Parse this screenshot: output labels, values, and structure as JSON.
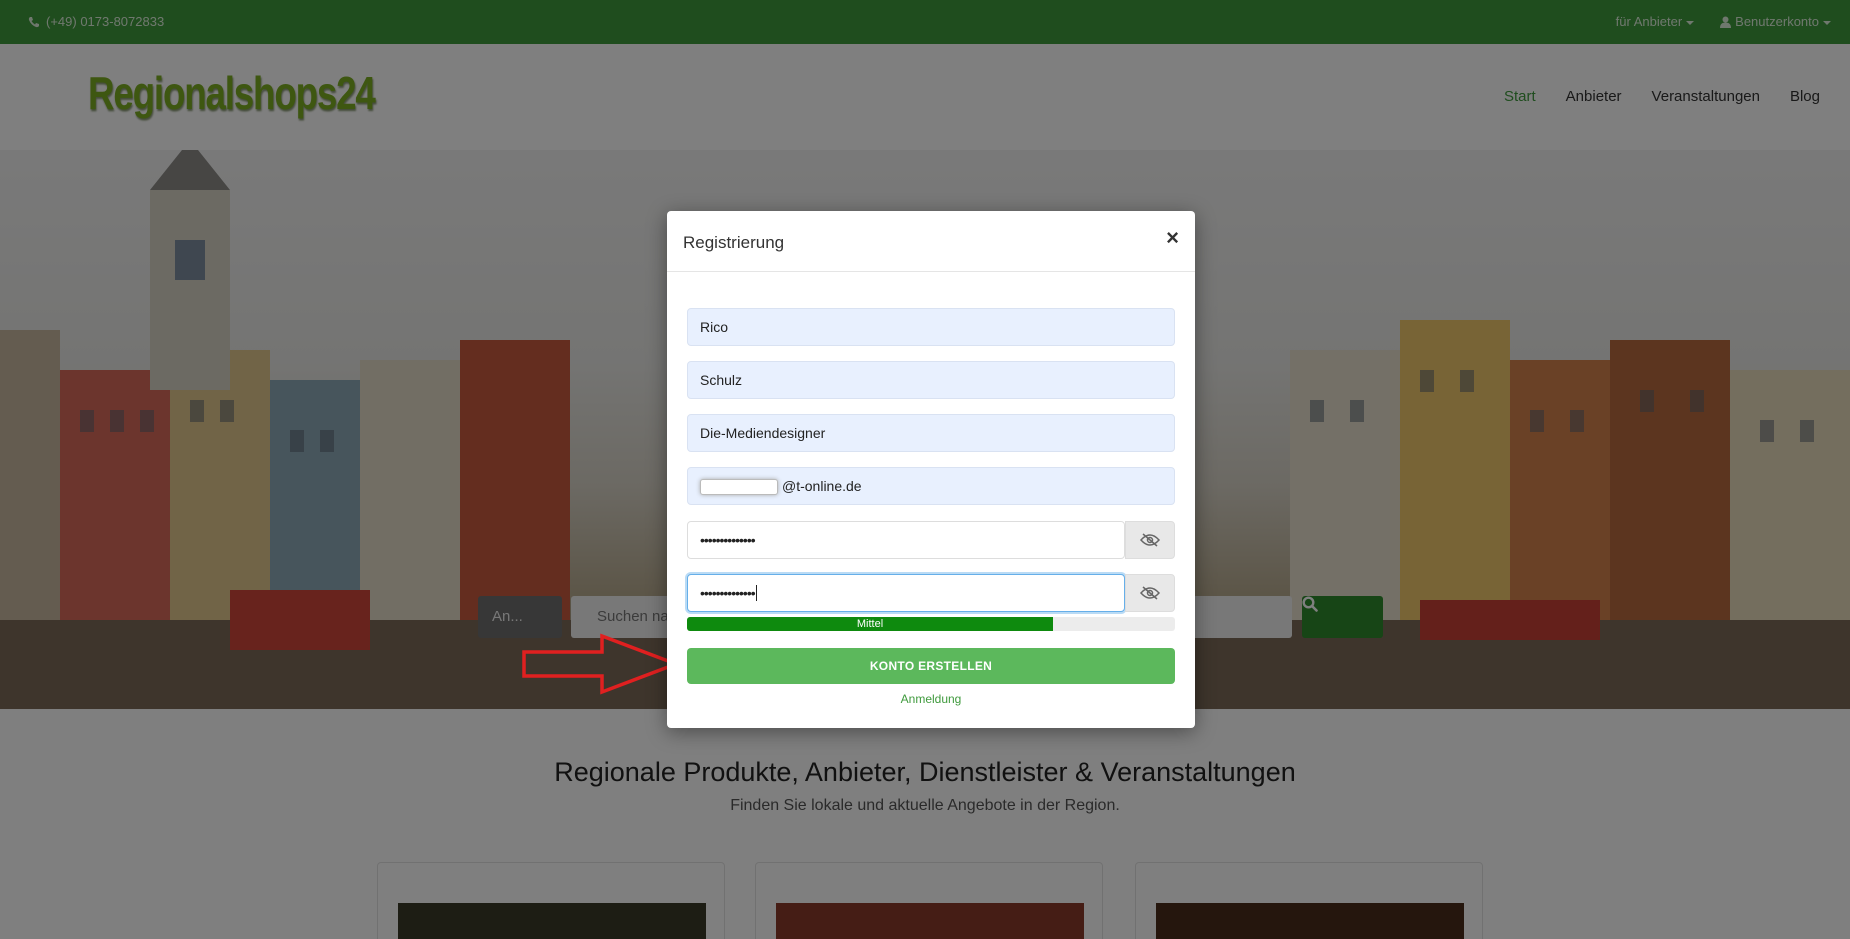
{
  "topbar": {
    "phone": "(+49) 0173-8072833",
    "for_providers": "für Anbieter",
    "account": "Benutzerkonto"
  },
  "header": {
    "logo": "Regionalshops24",
    "nav": [
      "Start",
      "Anbieter",
      "Veranstaltungen",
      "Blog"
    ]
  },
  "search": {
    "category": "An...",
    "placeholder": "Suchen nac"
  },
  "main": {
    "title": "Regionale Produkte, Anbieter, Dienstleister & Veranstaltungen",
    "subtitle": "Finden Sie lokale und aktuelle Angebote in der Region."
  },
  "modal": {
    "title": "Registrierung",
    "close": "×",
    "first_name": "Rico",
    "last_name": "Schulz",
    "company": "Die-Mediendesigner",
    "email_domain": "@t-online.de",
    "password": "••••••••••••••",
    "password_confirm": "••••••••••••••",
    "strength_label": "Mittel",
    "strength_level": 0.75,
    "submit": "KONTO ERSTELLEN",
    "login": "Anmeldung"
  },
  "colors": {
    "brand_green": "#3f9a3d",
    "button_green": "#5cb85c",
    "strength_green": "#0e8a0e",
    "annotation_arrow": "#e02020"
  }
}
